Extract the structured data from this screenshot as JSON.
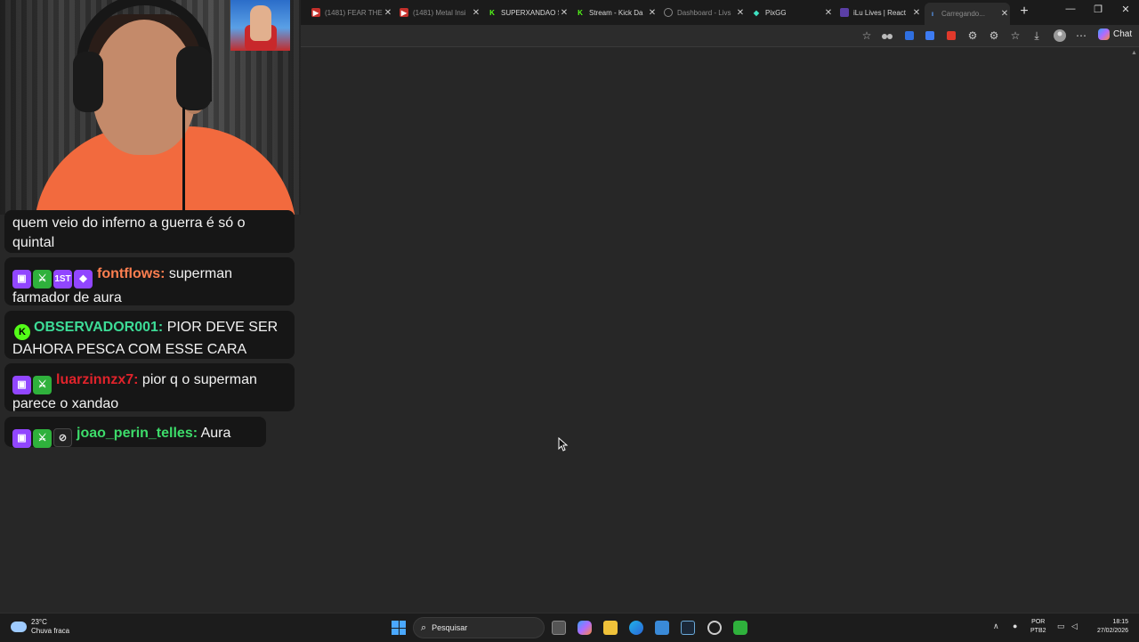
{
  "browser": {
    "tabs": [
      {
        "title": "(1481) FEAR THE",
        "icon": "youtube-icon",
        "dim": true
      },
      {
        "title": "(1481) Metal Insi",
        "icon": "youtube-icon",
        "dim": true
      },
      {
        "title": "SUPERXANDAO S",
        "icon": "kick-icon",
        "dim": false
      },
      {
        "title": "Stream - Kick Da",
        "icon": "kick-icon",
        "dim": false
      },
      {
        "title": "Dashboard - Livs",
        "icon": "globe-icon",
        "dim": true
      },
      {
        "title": "PixGG",
        "icon": "pixgg-icon",
        "dim": false
      },
      {
        "title": "iLu Lives | React",
        "icon": "ilu-icon",
        "dim": false
      },
      {
        "title": "Carregando...",
        "icon": "loading-icon",
        "dim": true,
        "active": true
      }
    ],
    "new_tab": "+",
    "chat_label": "Chat",
    "window_controls": {
      "minimize": "—",
      "restore": "❐",
      "close": "✕"
    }
  },
  "chat": {
    "messages": [
      {
        "id": "m1",
        "badges": [],
        "user": "",
        "user_color": "#ffffff",
        "text": "quem veio do inferno a guerra é só o quintal"
      },
      {
        "id": "m2",
        "badges": [
          "twitch",
          "sword",
          "first",
          "gem"
        ],
        "user": "fontflows:",
        "user_color": "#ff7f50",
        "text": "superman farmador de aura"
      },
      {
        "id": "m3",
        "badges": [
          "kick"
        ],
        "user": "OBSERVADOR001:",
        "user_color": "#3ddc97",
        "text": "PIOR DEVE SER DAHORA PESCA COM ESSE CARA"
      },
      {
        "id": "m4",
        "badges": [
          "twitch",
          "sword"
        ],
        "user": "luarzinnzx7:",
        "user_color": "#e0232b",
        "text": "pior q o superman parece o xandao"
      },
      {
        "id": "m5",
        "badges": [
          "twitch",
          "sword",
          "eye"
        ],
        "user": "joao_perin_telles:",
        "user_color": "#3ddc6a",
        "text": "Aura"
      }
    ]
  },
  "taskbar": {
    "weather": {
      "temp": "23°C",
      "desc": "Chuva fraca"
    },
    "search_placeholder": "Pesquisar",
    "lang": {
      "line1": "POR",
      "line2": "PTB2"
    },
    "clock": {
      "time": "18:15",
      "date": "27/02/2026"
    }
  }
}
